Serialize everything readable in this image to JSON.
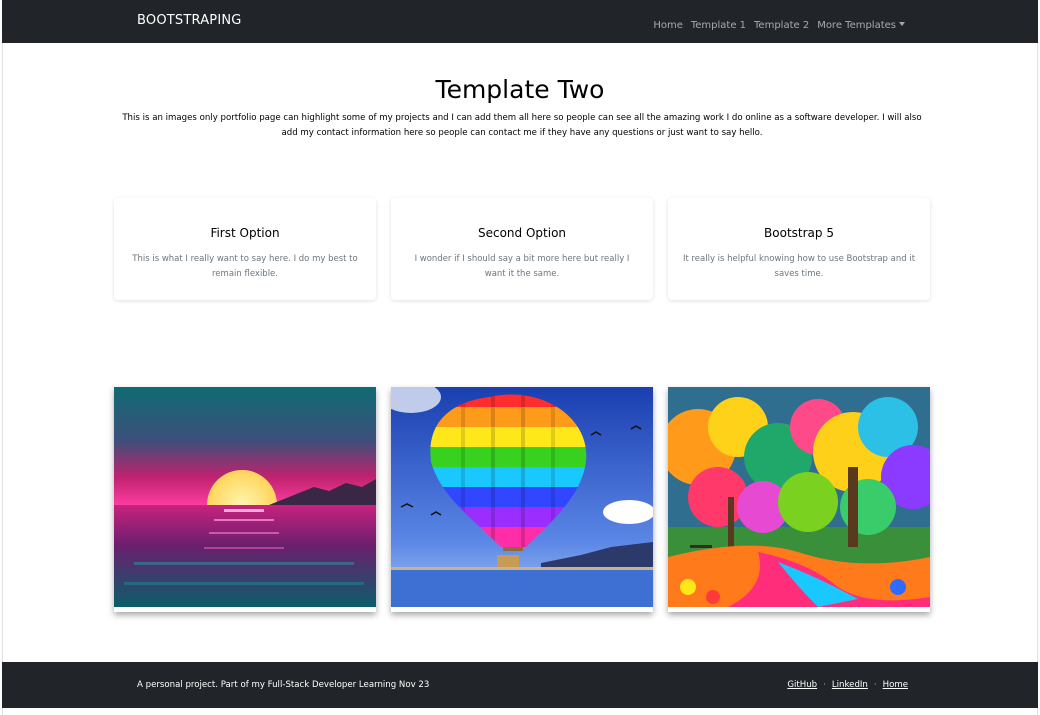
{
  "navbar": {
    "brand": "BOOTSTRAPING",
    "links": [
      "Home",
      "Template 1",
      "Template 2",
      "More Templates"
    ]
  },
  "hero": {
    "title": "Template Two",
    "text": "This is an images only portfolio page can highlight some of my projects and I can add them all here so people can see all the amazing work I do online as a software developer. I will also add my contact information here so people can contact me if they have any questions or just want to say hello."
  },
  "cards": [
    {
      "title": "First Option",
      "text": "This is what I really want to say here. I do my best to remain flexible."
    },
    {
      "title": "Second Option",
      "text": "I wonder if I should say a bit more here but really I want it the same."
    },
    {
      "title": "Bootstrap 5",
      "text": "It really is helpful knowing how to use Bootstrap and it saves time."
    }
  ],
  "images": [
    "sunset-sea-image",
    "hot-air-balloon-image",
    "colorful-forest-image"
  ],
  "footer": {
    "text": "A personal project. Part of my Full-Stack Developer Learning Nov 23",
    "links": [
      "GitHub",
      "LinkedIn",
      "Home"
    ],
    "separator": "·"
  },
  "colors": {
    "dark": "#212529",
    "muted": "#6c757d"
  }
}
